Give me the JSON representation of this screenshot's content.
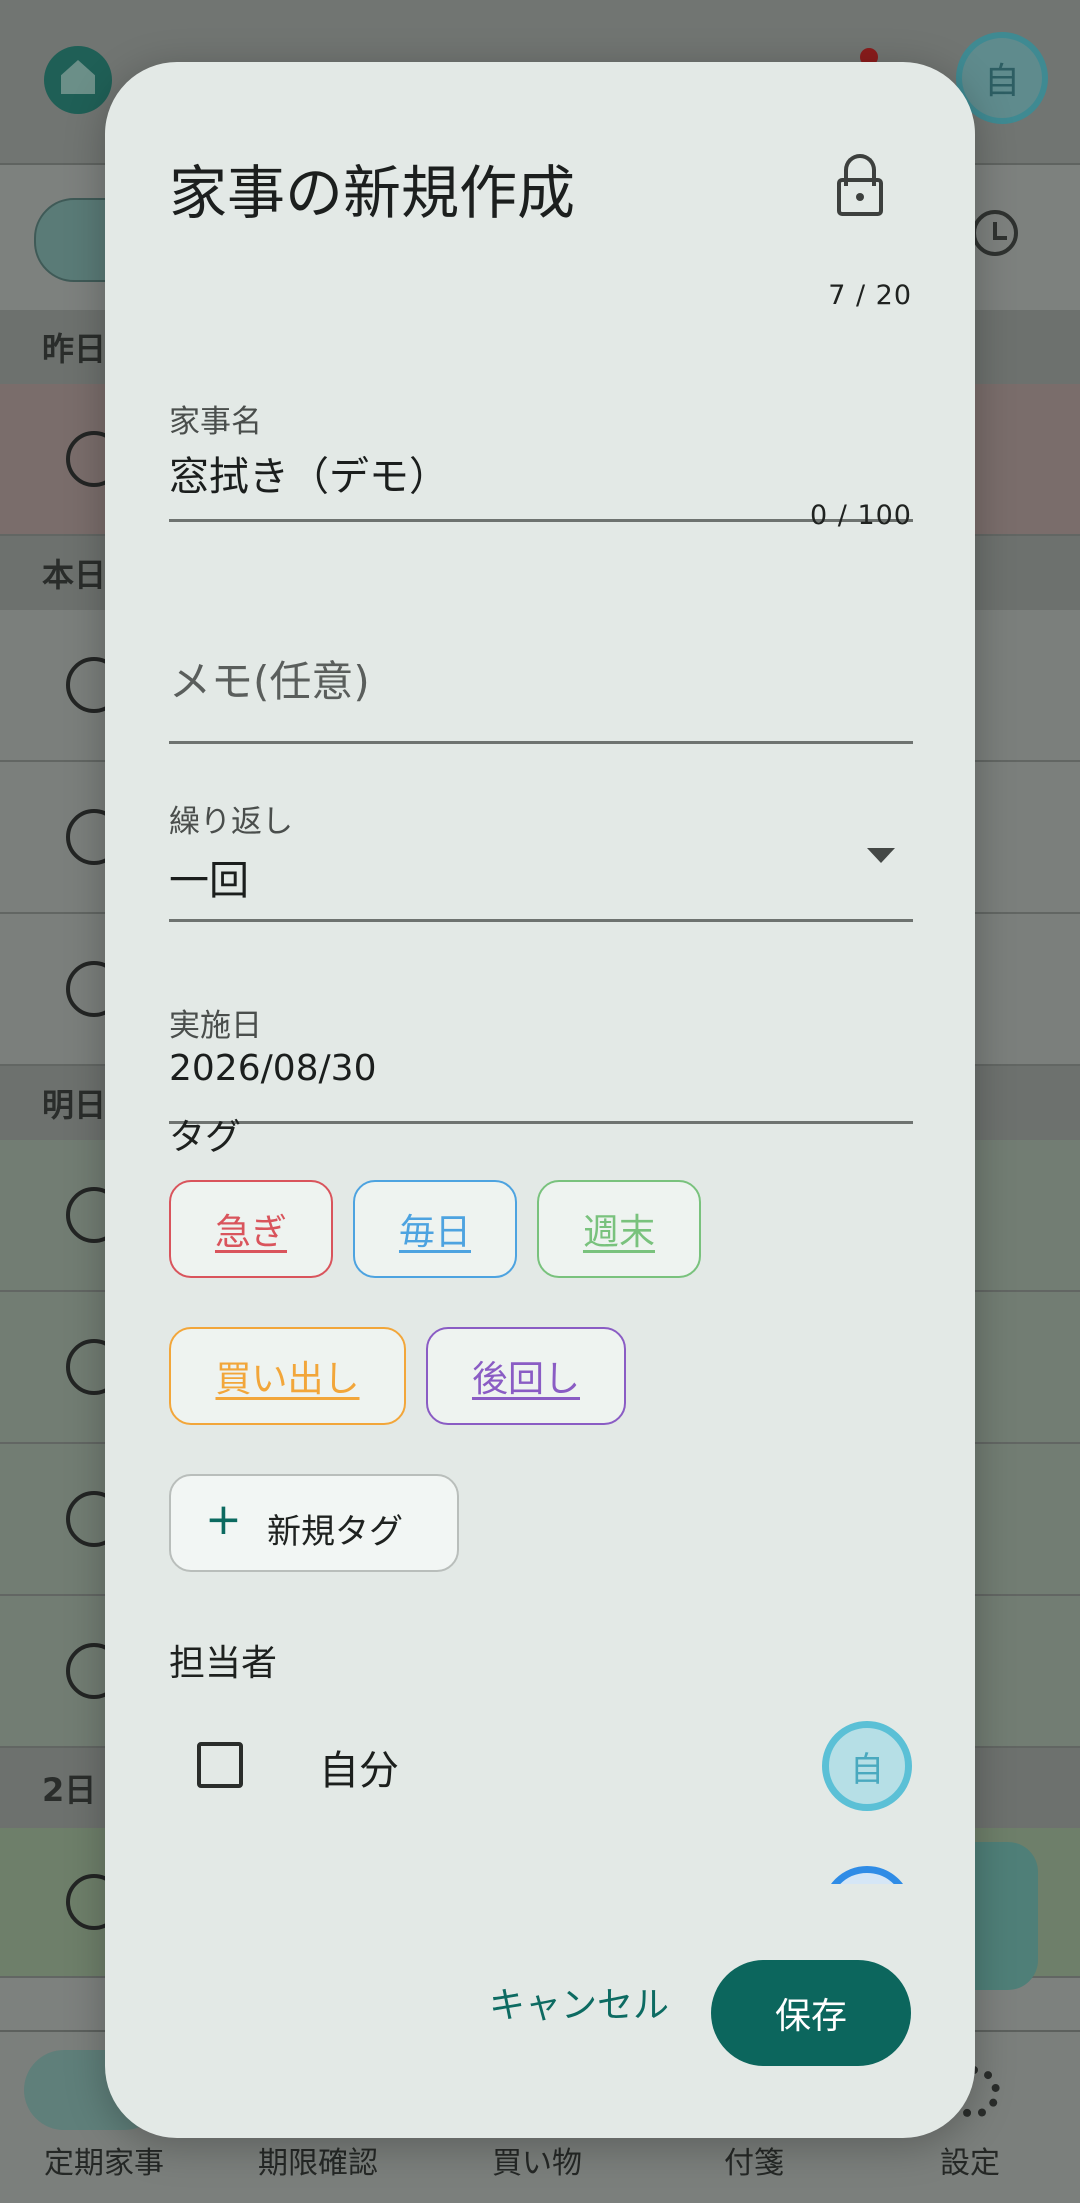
{
  "background": {
    "avatar_initial": "自",
    "sections": [
      "昨日",
      "本日",
      "明日",
      "2日"
    ],
    "bottom_nav": [
      "定期家事",
      "期限確認",
      "買い物",
      "付箋",
      "設定"
    ]
  },
  "dialog": {
    "title": "家事の新規作成",
    "name_field": {
      "counter": "7 / 20",
      "label": "家事名",
      "value": "窓拭き（デモ）"
    },
    "memo_field": {
      "counter": "0 / 100",
      "placeholder": "メモ(任意)"
    },
    "repeat_field": {
      "label": "繰り返し",
      "value": "一回"
    },
    "date_field": {
      "label": "実施日",
      "value": "2026/08/30"
    },
    "tags": {
      "label": "タグ",
      "items": [
        {
          "label": "急ぎ",
          "color": "#d9545c"
        },
        {
          "label": "毎日",
          "color": "#4da3e0"
        },
        {
          "label": "週末",
          "color": "#79c27d"
        },
        {
          "label": "買い出し",
          "color": "#f2a63a"
        },
        {
          "label": "後回し",
          "color": "#8a5cc4"
        }
      ],
      "add_label": "新規タグ"
    },
    "assignees": {
      "label": "担当者",
      "items": [
        {
          "name": "自分",
          "initial": "自",
          "checked": false
        }
      ]
    },
    "cancel_label": "キャンセル",
    "save_label": "保存"
  },
  "colors": {
    "primary": "#0c665d",
    "dialog_bg": "#e3e9e6"
  }
}
